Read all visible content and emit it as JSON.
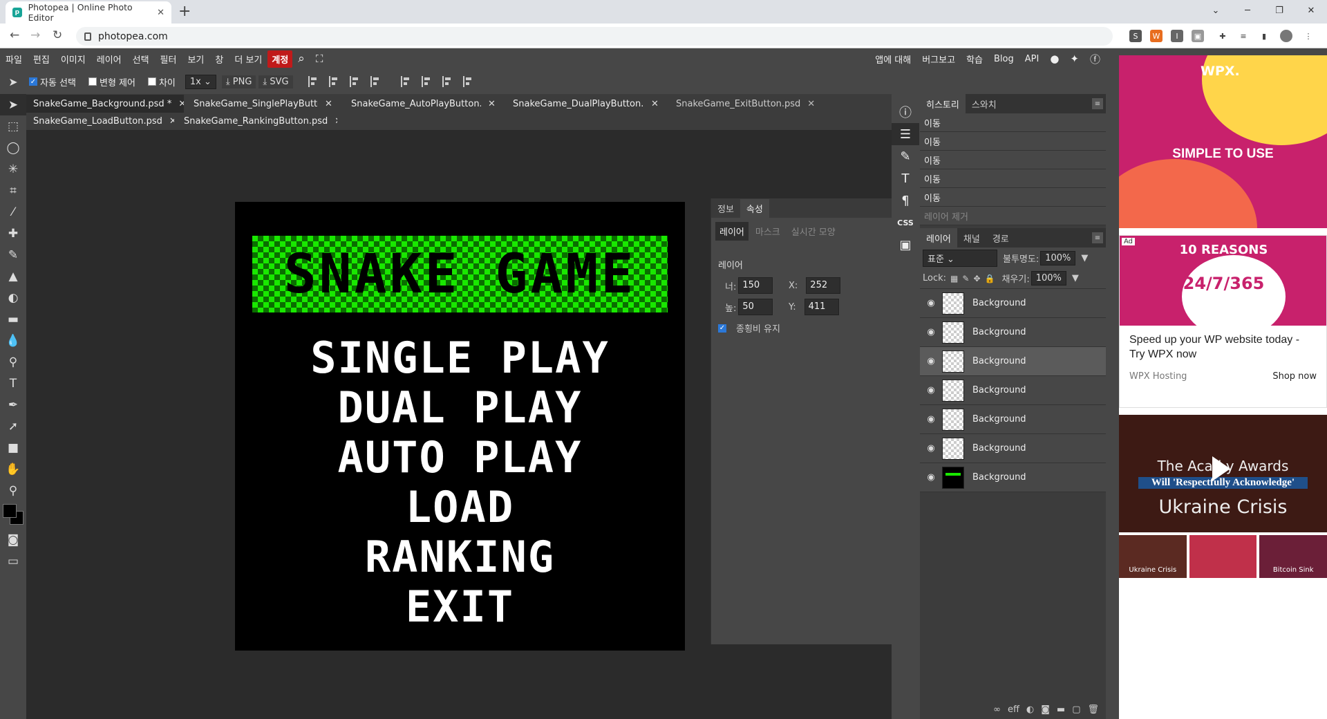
{
  "browser": {
    "tab_title": "Photopea | Online Photo Editor",
    "new_tab": "+",
    "url": "photopea.com",
    "window_controls": [
      "⌄",
      "─",
      "❐",
      "✕"
    ]
  },
  "menubar": {
    "items": [
      "파일",
      "편집",
      "이미지",
      "레이어",
      "선택",
      "필터",
      "보기",
      "창",
      "더 보기",
      "계정"
    ],
    "right_items": [
      "앱에 대해",
      "버그보고",
      "학습",
      "Blog",
      "API"
    ]
  },
  "options": {
    "auto_select": "자동 선택",
    "transform": "변형 제어",
    "distance": "차이",
    "zoom": "1x",
    "png": "PNG",
    "svg": "SVG"
  },
  "doc_tabs": [
    {
      "label": "SnakeGame_Background.psd *",
      "active": true
    },
    {
      "label": "SnakeGame_SinglePlayButton.",
      "active": false
    },
    {
      "label": "SnakeGame_AutoPlayButton.ps",
      "active": false
    },
    {
      "label": "SnakeGame_DualPlayButton.ps",
      "active": false
    },
    {
      "label": "SnakeGame_ExitButton.psd",
      "active": false
    },
    {
      "label": "SnakeGame_LoadButton.psd",
      "active": false
    },
    {
      "label": "SnakeGame_RankingButton.psd",
      "active": false
    }
  ],
  "canvas": {
    "title": "SNAKE GAME",
    "menu": [
      "SINGLE PLAY",
      "DUAL PLAY",
      "AUTO PLAY",
      "LOAD",
      "RANKING",
      "EXIT"
    ],
    "title_color": "#19e800"
  },
  "properties": {
    "tabs": [
      "정보",
      "속성"
    ],
    "subtabs": [
      "레이어",
      "마스크",
      "실시간 모양"
    ],
    "section": "레이어",
    "w_label": "너:",
    "w": "150",
    "x_label": "X:",
    "x": "252",
    "h_label": "높:",
    "h": "50",
    "y_label": "Y:",
    "y": "411",
    "keep_ratio": "종횡비 유지"
  },
  "history": {
    "tabs": [
      "히스토리",
      "스와치"
    ],
    "items": [
      "이동",
      "이동",
      "이동",
      "이동",
      "이동",
      "레이어 제거"
    ]
  },
  "layers": {
    "tabs": [
      "레이어",
      "채널",
      "경로"
    ],
    "blend": "표준",
    "opacity_label": "불투명도:",
    "opacity": "100%",
    "lock_label": "Lock:",
    "fill_label": "채우기:",
    "fill": "100%",
    "items": [
      "Background",
      "Background",
      "Background",
      "Background",
      "Background",
      "Background",
      "Background"
    ]
  },
  "ads": {
    "ad1_logo": "WPX.",
    "ad1_text": "SIMPLE TO USE",
    "ad2_badge": "Ad",
    "ad2_head": "10 REASONS",
    "ad2_num": "24/7/365",
    "ad2_text": "Speed up your WP website today - Try WPX now",
    "ad2_source": "WPX Hosting",
    "ad2_cta": "Shop now",
    "ad3_l1": "The Acad    y Awards",
    "ad3_l2": "Will 'Respectfully Acknowledge'",
    "ad3_l3": "Ukraine Crisis",
    "ad4": [
      "Ukraine Crisis",
      "",
      "Bitcoin Sink"
    ]
  }
}
